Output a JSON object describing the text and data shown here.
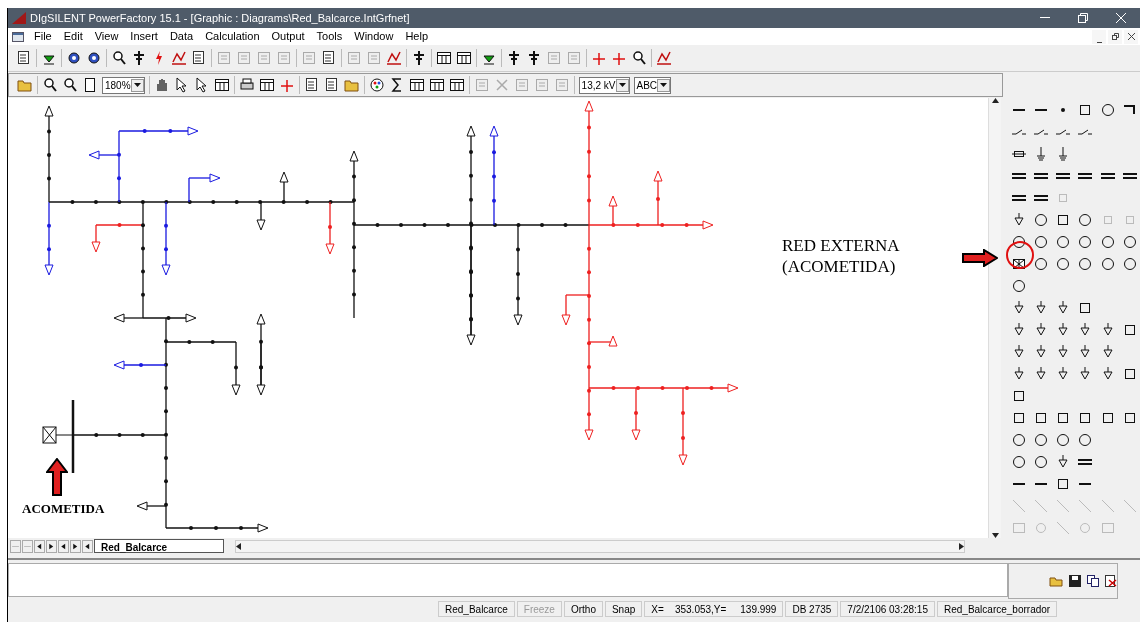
{
  "window": {
    "title": "DIgSILENT PowerFactory 15.1 - [Graphic : Diagrams\\Red_Balcarce.IntGrfnet]"
  },
  "menu": [
    "File",
    "Edit",
    "View",
    "Insert",
    "Data",
    "Calculation",
    "Output",
    "Tools",
    "Window",
    "Help"
  ],
  "toolbar": {
    "zoom": "180%",
    "voltage": "13,2 kV",
    "phase": "ABC"
  },
  "annotations": [
    {
      "kind": "palette",
      "text": "RED EXTERNA\n(ACOMETIDA)"
    },
    {
      "kind": "diagram",
      "text": "ACOMETIDA"
    }
  ],
  "sheet_tabs": [
    {
      "label": "Red_Balcarce",
      "selected": true
    }
  ],
  "status_bar": [
    {
      "text": "Red_Balcarce",
      "disabled": false
    },
    {
      "text": "Freeze",
      "disabled": true
    },
    {
      "text": "Ortho",
      "disabled": false
    },
    {
      "text": "Snap",
      "disabled": false
    },
    {
      "text": "X=    353.053,Y=     139.999",
      "disabled": false
    },
    {
      "text": "DB 2735",
      "disabled": false
    },
    {
      "text": "7/2/2106 03:28:15",
      "disabled": false
    },
    {
      "text": "Red_Balcarce_borrador",
      "disabled": false
    }
  ]
}
